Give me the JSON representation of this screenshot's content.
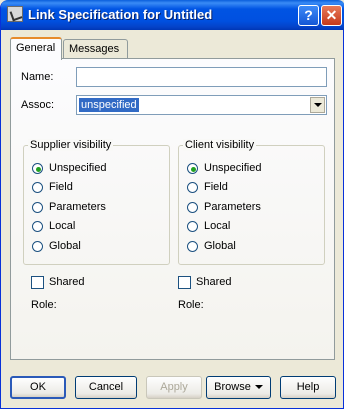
{
  "window": {
    "title": "Link Specification for Untitled"
  },
  "titlebar_buttons": {
    "help": "?",
    "close": "✕"
  },
  "tabs": [
    {
      "label": "General",
      "active": true
    },
    {
      "label": "Messages",
      "active": false
    }
  ],
  "form": {
    "name_label": "Name:",
    "name_value": "",
    "assoc_label": "Assoc:",
    "assoc_value": "unspecified"
  },
  "supplier": {
    "title": "Supplier visibility",
    "options": [
      "Unspecified",
      "Field",
      "Parameters",
      "Local",
      "Global"
    ],
    "selected": "Unspecified",
    "shared_label": "Shared",
    "role_label": "Role:"
  },
  "client": {
    "title": "Client visibility",
    "options": [
      "Unspecified",
      "Field",
      "Parameters",
      "Local",
      "Global"
    ],
    "selected": "Unspecified",
    "shared_label": "Shared",
    "role_label": "Role:"
  },
  "buttons": {
    "ok": "OK",
    "cancel": "Cancel",
    "apply": "Apply",
    "browse": "Browse",
    "help": "Help"
  },
  "colors": {
    "titlebar": "#0054e3",
    "selection": "#316ac5",
    "radio_checked": "#21a121"
  }
}
